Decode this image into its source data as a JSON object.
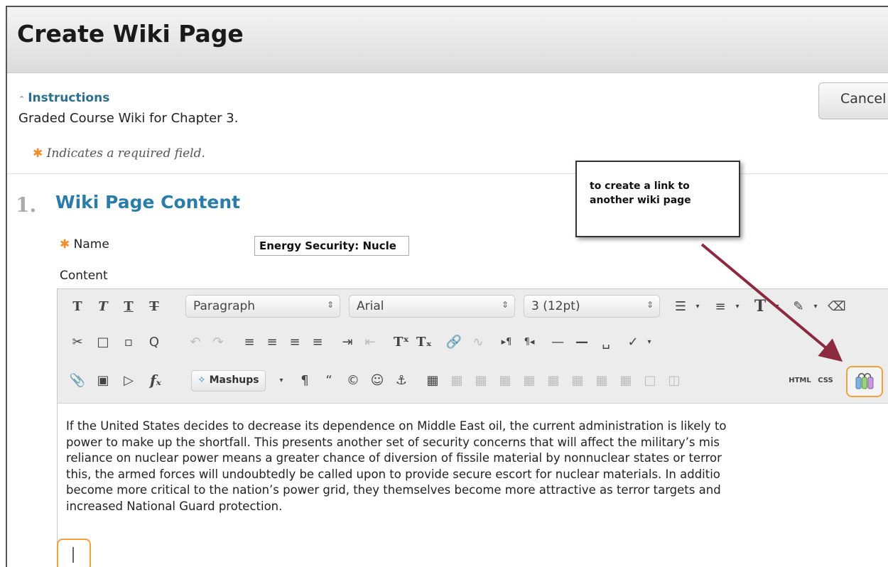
{
  "page": {
    "title": "Create Wiki Page",
    "instructions_link": "Instructions",
    "instructions_text": "Graded Course Wiki for Chapter 3.",
    "cancel_label": "Cancel",
    "required_note": "Indicates a required field.",
    "required_star": "✱"
  },
  "section": {
    "number": "1.",
    "title": "Wiki Page Content",
    "name_label": "Name",
    "name_value": "Energy Security: Nucle",
    "content_label": "Content"
  },
  "editor": {
    "paragraph_select": "Paragraph",
    "font_select": "Arial",
    "size_select": "3 (12pt)",
    "mashups_label": "Mashups",
    "html_label": "HTML",
    "css_label": "CSS",
    "body_lines": [
      "If the United States decides to decrease its dependence on Middle East oil, the current administration is likely to",
      "power to make up the shortfall. This presents another set of security concerns that will affect the military’s mis",
      "reliance on nuclear power means a greater chance of diversion of fissile material by nonnuclear states or terror",
      "this, the armed forces will undoubtedly be called upon to provide secure escort for nuclear materials. In additio",
      "become more critical to the nation’s power grid, they themselves become more attractive as terror targets and",
      "increased National Guard protection."
    ]
  },
  "annotation": {
    "callout_text": "to create a link to another wiki page",
    "highlight_color": "#f3a23b",
    "arrow_color": "#8c2a40"
  }
}
